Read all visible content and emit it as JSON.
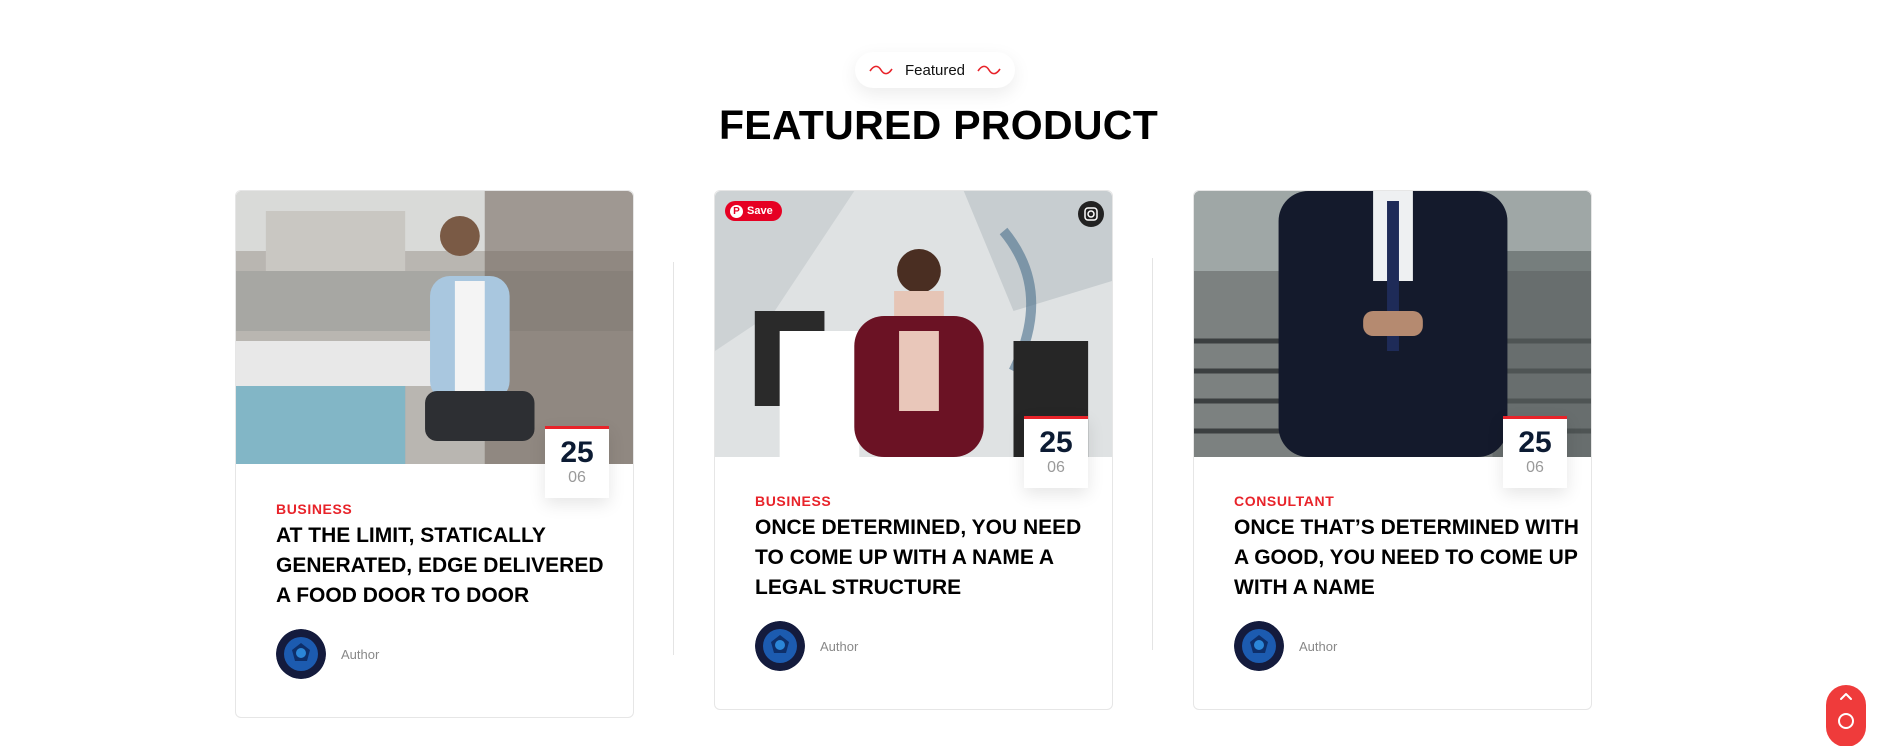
{
  "section": {
    "eyebrow": "Featured",
    "title": "FEATURED PRODUCT"
  },
  "accent_color": "#e8232a",
  "cards": [
    {
      "image": "man-laughing-with-phone-cafe",
      "date": {
        "day": "25",
        "month": "06"
      },
      "category": "BUSINESS",
      "title": "AT THE LIMIT, STATICALLY GENERATED, EDGE DELIVERED A FOOD DOOR TO DOOR",
      "author": "Author"
    },
    {
      "image": "woman-with-shopping-bags",
      "date": {
        "day": "25",
        "month": "06"
      },
      "category": "BUSINESS",
      "title": "ONCE DETERMINED, YOU NEED TO COME UP WITH A NAME A LEGAL STRUCTURE",
      "author": "Author",
      "save_label": "Save"
    },
    {
      "image": "man-in-suit-on-stairs",
      "date": {
        "day": "25",
        "month": "06"
      },
      "category": "CONSULTANT",
      "title": "ONCE THAT’S DETERMINED WITH A GOOD, YOU NEED TO COME UP WITH A NAME",
      "author": "Author"
    }
  ],
  "icons": {
    "wave": "wave-icon",
    "pinterest": "pinterest-icon",
    "lens": "visual-search-icon",
    "scroll": "scroll-top-icon"
  }
}
